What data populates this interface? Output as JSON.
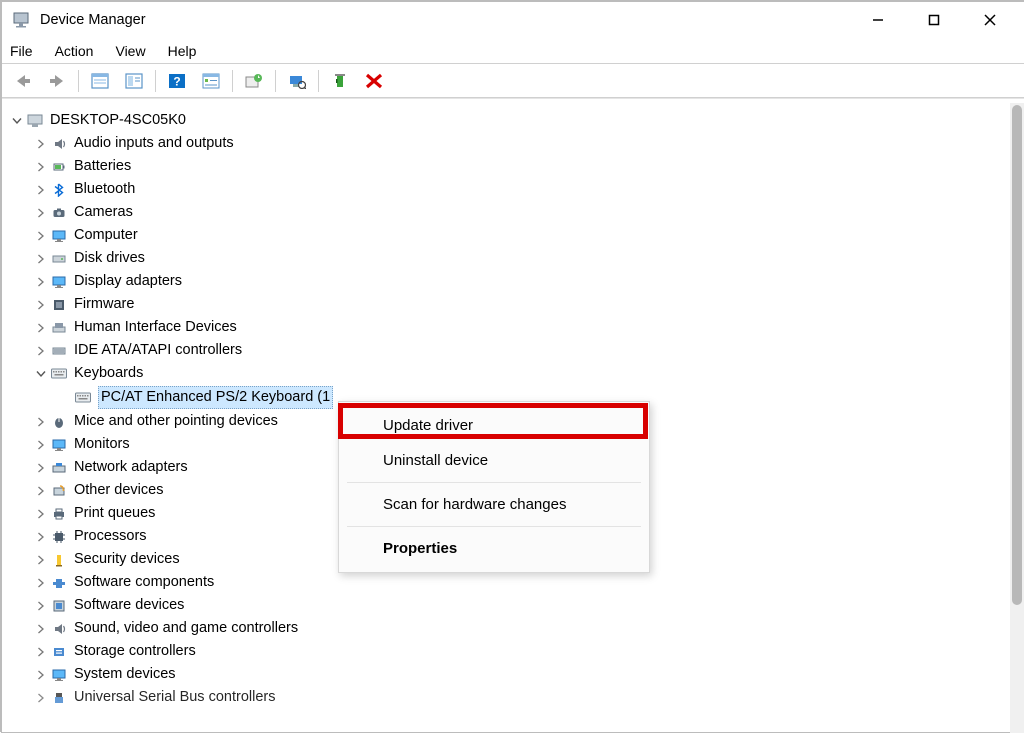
{
  "window": {
    "title": "Device Manager"
  },
  "menu": {
    "file": "File",
    "action": "Action",
    "view": "View",
    "help": "Help"
  },
  "tree": {
    "root": "DESKTOP-4SC05K0",
    "nodes": [
      "Audio inputs and outputs",
      "Batteries",
      "Bluetooth",
      "Cameras",
      "Computer",
      "Disk drives",
      "Display adapters",
      "Firmware",
      "Human Interface Devices",
      "IDE ATA/ATAPI controllers",
      "Keyboards",
      "Mice and other pointing devices",
      "Monitors",
      "Network adapters",
      "Other devices",
      "Print queues",
      "Processors",
      "Security devices",
      "Software components",
      "Software devices",
      "Sound, video and game controllers",
      "Storage controllers",
      "System devices",
      "Universal Serial Bus controllers"
    ],
    "keyboard_child": "PC/AT Enhanced PS/2 Keyboard (1"
  },
  "context_menu": {
    "update": "Update driver",
    "uninstall": "Uninstall device",
    "scan": "Scan for hardware changes",
    "properties": "Properties"
  }
}
